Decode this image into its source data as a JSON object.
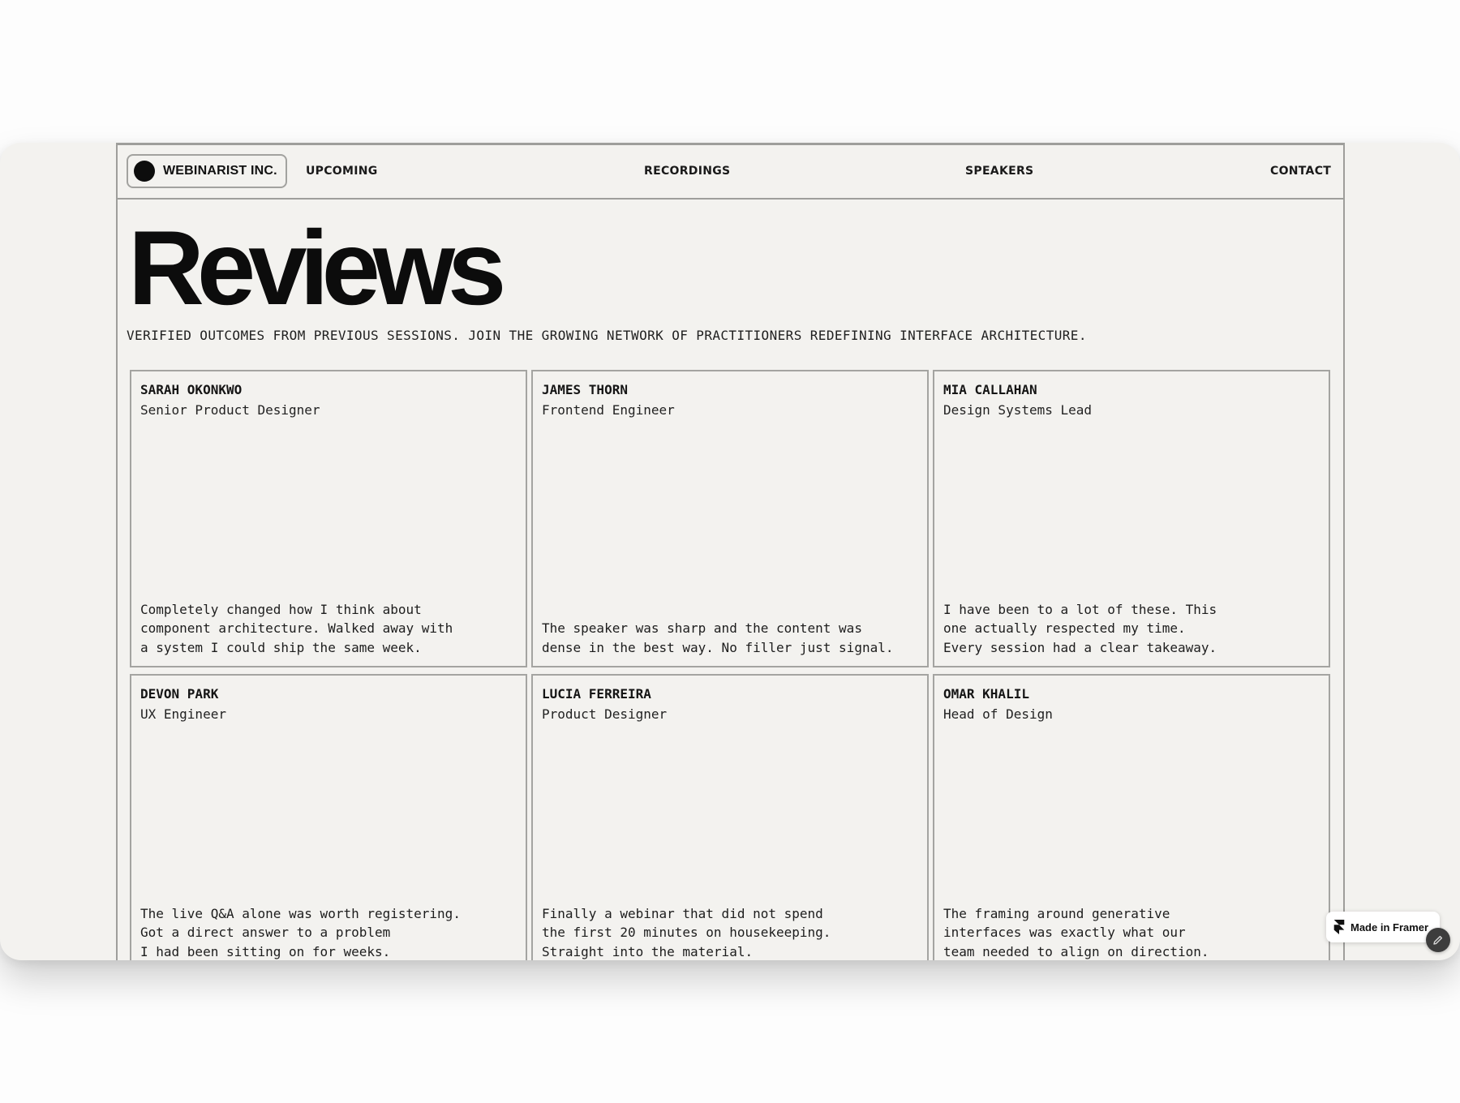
{
  "header": {
    "brand": "WEBINARIST INC.",
    "nav": {
      "upcoming": "UPCOMING",
      "recordings": "RECORDINGS",
      "speakers": "SPEAKERS",
      "contact": "CONTACT"
    }
  },
  "hero": {
    "title": "Reviews",
    "subtitle": "VERIFIED OUTCOMES FROM PREVIOUS SESSIONS. JOIN THE GROWING NETWORK OF PRACTITIONERS REDEFINING INTERFACE ARCHITECTURE."
  },
  "reviews": [
    {
      "name": "SARAH OKONKWO",
      "role": "Senior Product Designer",
      "quote": "Completely changed how I think about\ncomponent architecture. Walked away with\na system I could ship the same week."
    },
    {
      "name": "JAMES THORN",
      "role": "Frontend Engineer",
      "quote": "The speaker was sharp and the content was\ndense in the best way. No filler just signal."
    },
    {
      "name": "MIA CALLAHAN",
      "role": "Design Systems Lead",
      "quote": "I have been to a lot of these. This\none actually respected my time.\nEvery session had a clear takeaway."
    },
    {
      "name": "DEVON PARK",
      "role": "UX Engineer",
      "quote": "The live Q&A alone was worth registering.\nGot a direct answer to a problem\nI had been sitting on for weeks."
    },
    {
      "name": "LUCIA FERREIRA",
      "role": "Product Designer",
      "quote": "Finally a webinar that did not spend\nthe first 20 minutes on housekeeping.\nStraight into the material."
    },
    {
      "name": "OMAR KHALIL",
      "role": "Head of Design",
      "quote": "The framing around generative\ninterfaces was exactly what our\nteam needed to align on direction."
    }
  ],
  "badge": {
    "label": "Made in Framer",
    "icon": "framer-icon"
  },
  "fab": {
    "icon": "pencil-icon"
  },
  "colors": {
    "background": "#f3f2ef",
    "border": "#9e9e9b",
    "text": "#111111",
    "fab": "#3d3d3d"
  }
}
